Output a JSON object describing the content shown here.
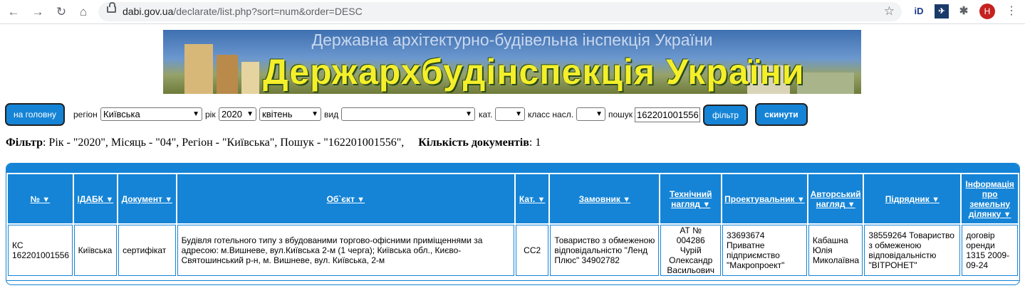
{
  "browser": {
    "url_domain": "dabi.gov.ua",
    "url_path": "/declarate/list.php?sort=num&order=DESC",
    "avatar_letter": "H"
  },
  "banner": {
    "subtitle": "Державна архітектурно-будівельна інспекція України",
    "title": "Держархбудінспекція України"
  },
  "filters": {
    "home_button": "на головну",
    "region_label": "регіон",
    "region_value": "Київська",
    "year_label": "рік",
    "year_value": "2020",
    "month_value": "квітень",
    "type_label": "вид",
    "type_value": "",
    "category_label": "кат.",
    "category_value": "",
    "class_label": "класс насл.",
    "class_value": "",
    "search_label": "пошук",
    "search_value": "162201001556",
    "filter_button": "фільтр",
    "reset_button": "скинути"
  },
  "summary": {
    "filter_label": "Фільтр",
    "filter_text": ": Рік - \"2020\", Місяць - \"04\", Регіон - \"Київська\", Пошук - \"162201001556\",",
    "count_label": "Кількість документів",
    "count_value": ": 1"
  },
  "table": {
    "headers": [
      "№",
      "ІДАБК",
      "Документ",
      "Об`єкт",
      "Кат.",
      "Замовник",
      "Технічний нагляд",
      "Проектувальник",
      "Авторський нагляд",
      "Підрядник",
      "Інформація про земельну ділянку"
    ],
    "rows": [
      [
        "КС 162201001556",
        "Київська",
        "сертифікат",
        "Будівля готельного типу з вбудованими торгово-офісними приміщеннями за адресою: м.Вишневе, вул.Київська 2-м (1 черга); Київська обл., Києво-Святошинський р-н, м. Вишневе, вул. Київська, 2-м",
        "СС2",
        "Товариство з обмеженою відповідальністю \"Ленд Плюс\" 34902782",
        "АТ № 004286 Чурій Олександр Васильович",
        "33693674 Приватне підприємство \"Макропроект\"",
        "Кабашна Юлія Миколаївна",
        "38559264 Товариство з обмеженою відповідальністю \"ВІТРОНЕТ\"",
        "договір оренди 1315 2009-09-24"
      ]
    ]
  },
  "colors": {
    "accent": "#1584d6"
  }
}
